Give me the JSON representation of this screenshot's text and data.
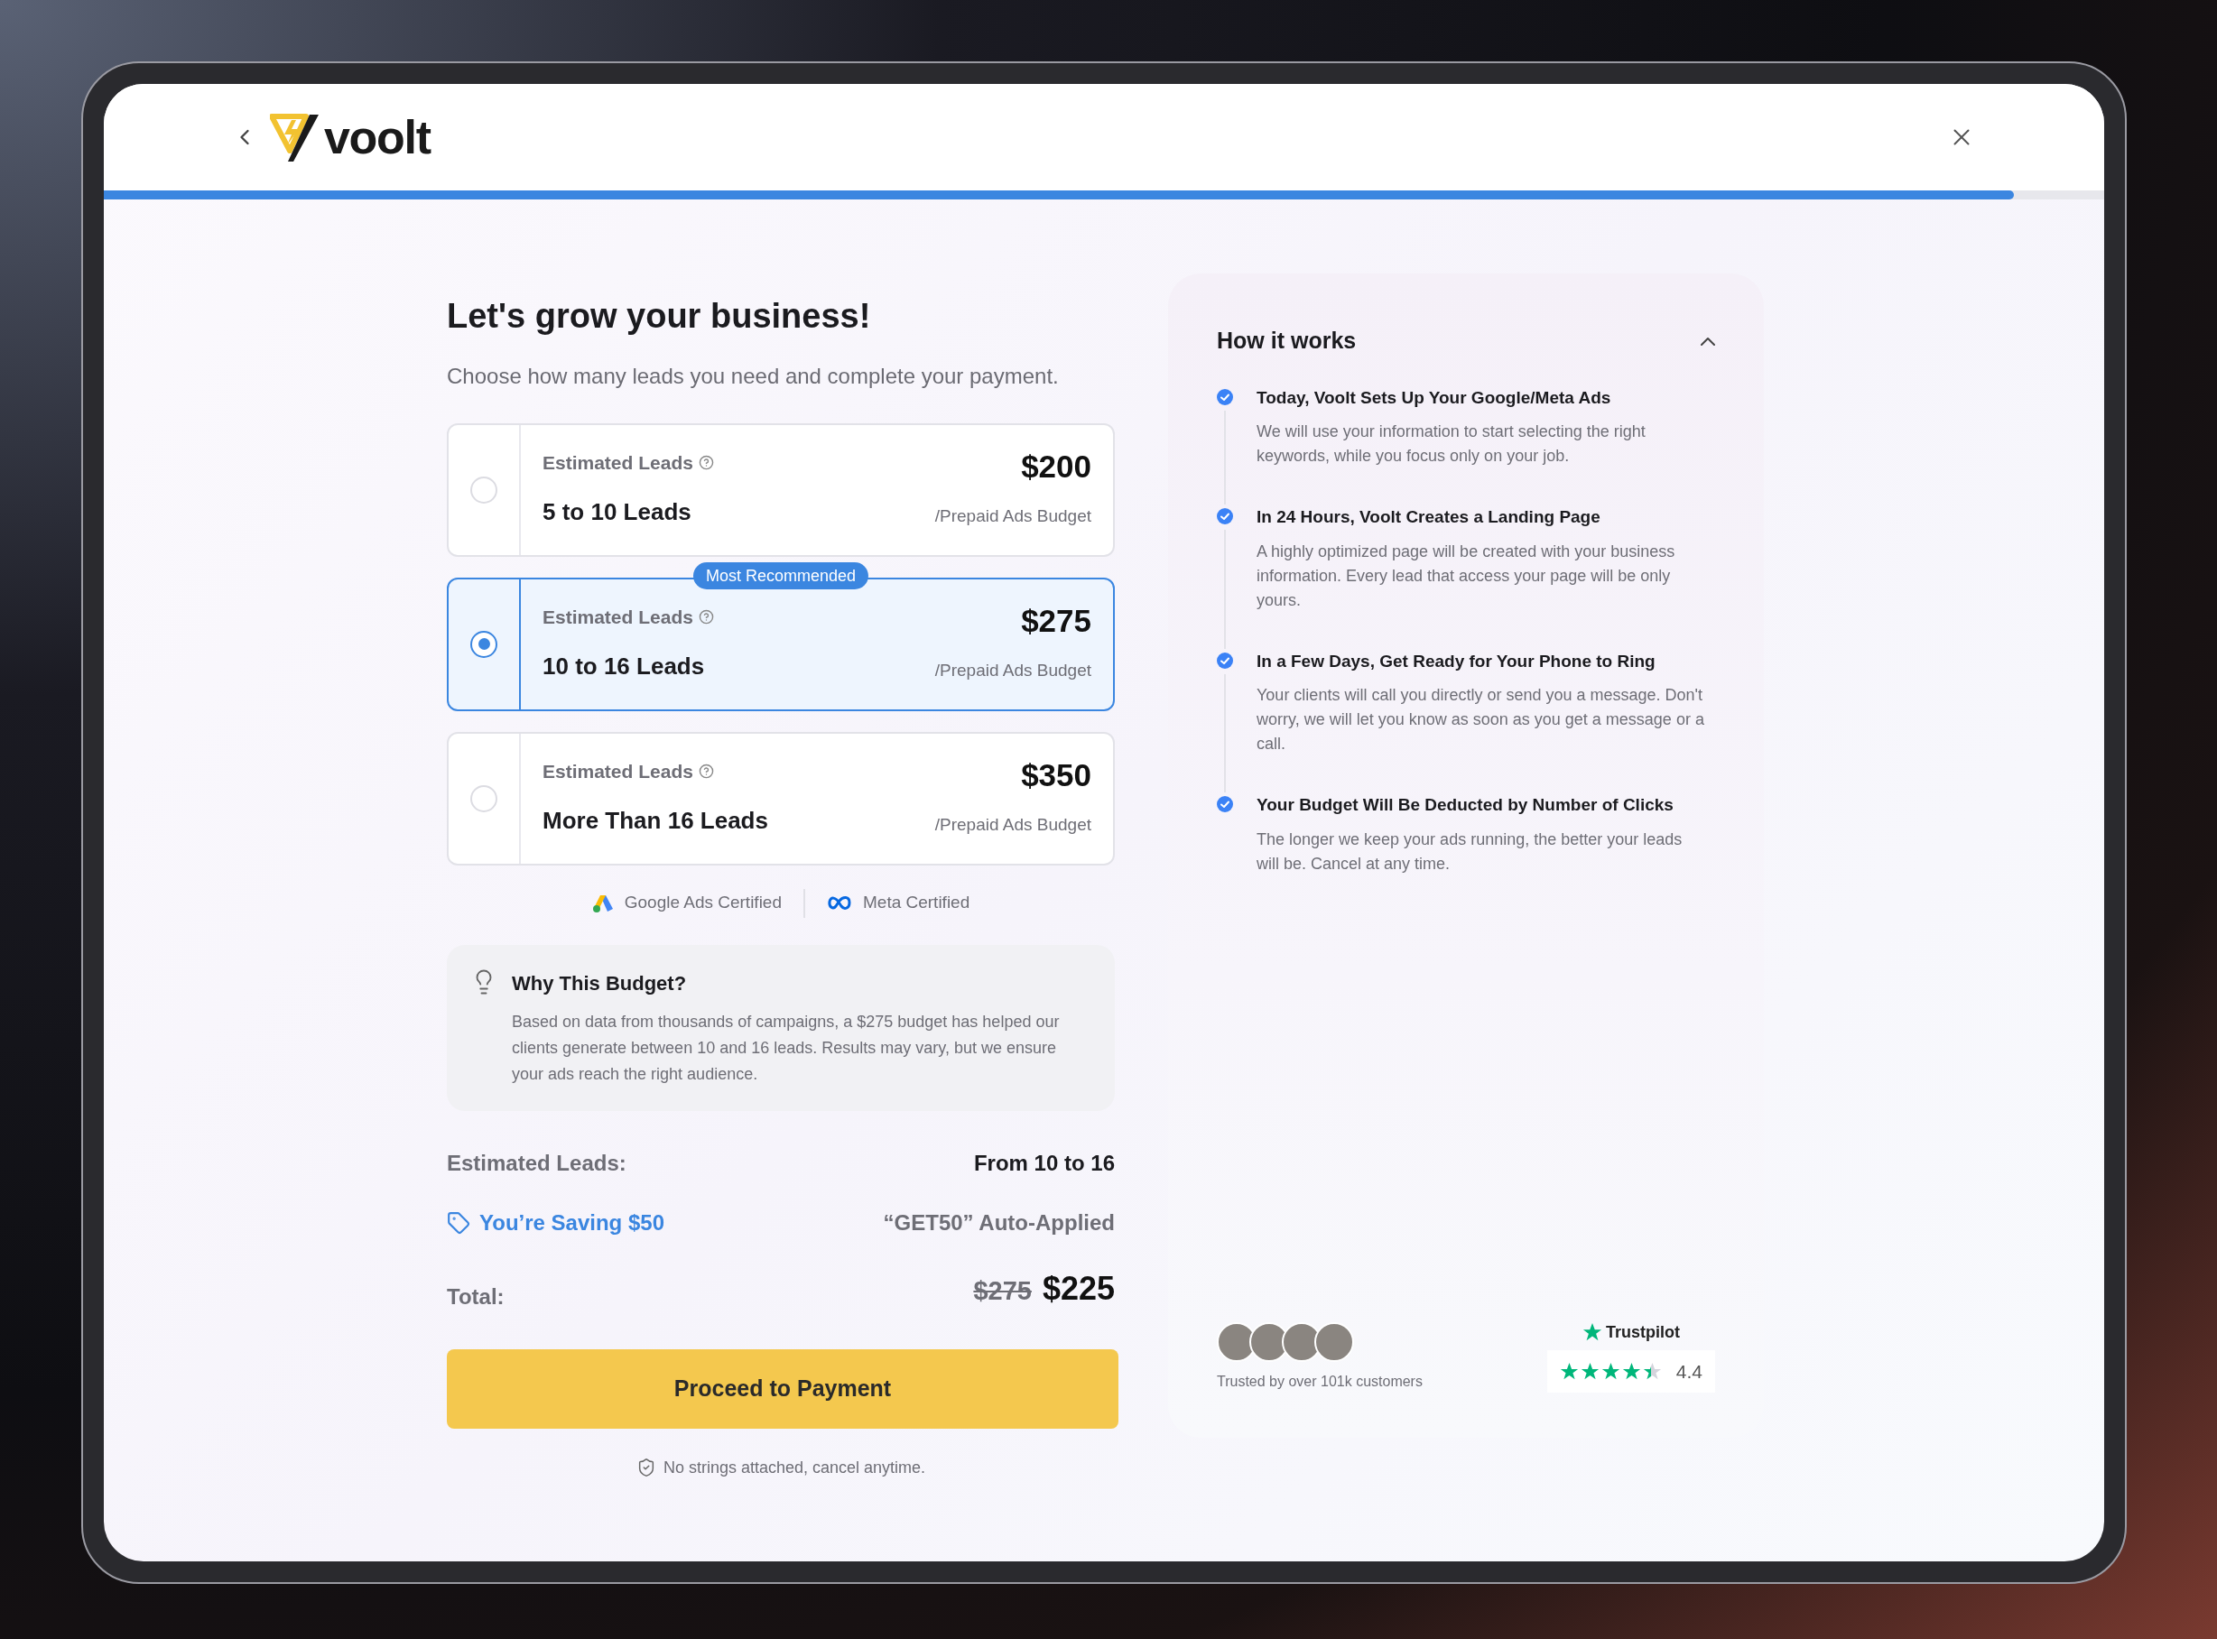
{
  "header": {
    "logo_text": "voolt",
    "progress": {
      "level": 0.955
    }
  },
  "heading": "Let's grow your business!",
  "subtitle": "Choose how many leads you need and complete your payment.",
  "options": [
    {
      "label": "Estimated Leads",
      "leads": "5 to 10 Leads",
      "price": "$200",
      "note": "/Prepaid Ads Budget",
      "selected": false
    },
    {
      "label": "Estimated Leads",
      "leads": "10 to 16 Leads",
      "price": "$275",
      "note": "/Prepaid Ads Budget",
      "selected": true,
      "badge": "Most Recommended"
    },
    {
      "label": "Estimated Leads",
      "leads": "More Than 16 Leads",
      "price": "$350",
      "note": "/Prepaid Ads Budget",
      "selected": false
    }
  ],
  "certifications": [
    {
      "kind": "google",
      "label": "Google Ads Certified"
    },
    {
      "kind": "meta",
      "label": "Meta Certified"
    }
  ],
  "why_budget": {
    "title": "Why This Budget?",
    "body": "Based on data from thousands of campaigns, a $275 budget has helped our clients generate between 10 and 16 leads. Results may vary, but we ensure your ads reach the right audience."
  },
  "summary": {
    "estimated_label": "Estimated Leads:",
    "estimated_value": "From 10 to 16",
    "saving": "You’re Saving $50",
    "code": "“GET50” Auto-Applied",
    "total_label": "Total:",
    "old_total": "$275",
    "total": "$225"
  },
  "cta": "Proceed to Payment",
  "guarantee": "No strings attached, cancel anytime.",
  "how_it_works": {
    "title": "How it works",
    "expanded": true,
    "steps": [
      {
        "title": "Today, Voolt Sets Up Your Google/Meta Ads",
        "body": "We will use your information to start selecting the right keywords, while you focus only on your job."
      },
      {
        "title": "In 24 Hours, Voolt Creates a Landing Page",
        "body": "A highly optimized page will be created with your business information. Every lead that access your page will be only yours."
      },
      {
        "title": "In a Few Days, Get Ready for Your Phone to Ring",
        "body": "Your clients will call you directly or send you a message. Don't worry, we will let you know as soon as you get a message or a call."
      },
      {
        "title": "Your Budget Will Be Deducted by Number of Clicks",
        "body": "The longer we keep your ads running, the better your leads will be. Cancel at any time."
      }
    ]
  },
  "social": {
    "trusted": "Trusted by over 101k customers",
    "trustpilot": {
      "name": "Trustpilot",
      "stars": 4.4,
      "rating": "4.4"
    }
  }
}
